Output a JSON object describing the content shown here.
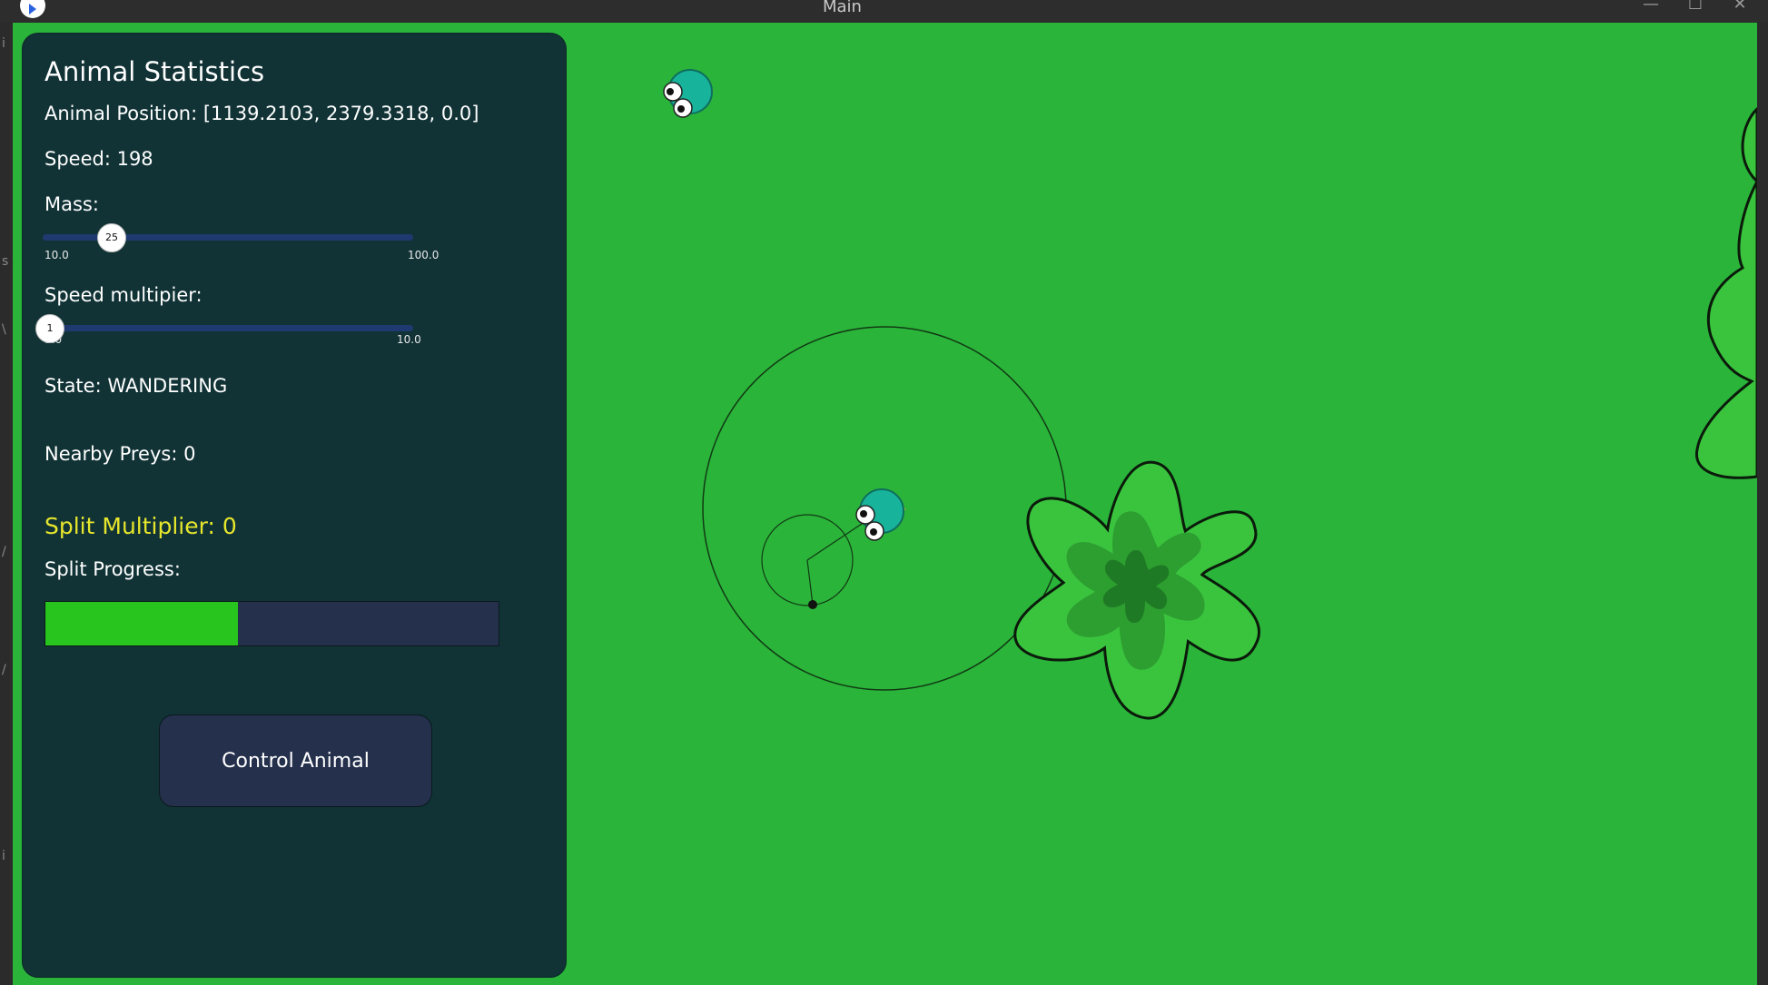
{
  "window": {
    "title": "Main",
    "minimize": "—",
    "maximize": "☐",
    "close": "✕"
  },
  "panel": {
    "title": "Animal Statistics",
    "position": "Animal Position: [1139.2103, 2379.3318, 0.0]",
    "speed": "Speed: 198",
    "mass_label": "Mass:",
    "mass_slider": {
      "value": 25,
      "value_label": "25",
      "min_label": "10.0",
      "max_label": "100.0",
      "min": 10,
      "max": 100
    },
    "speed_mult_label": "Speed multipier:",
    "speed_slider": {
      "value": 1,
      "value_label": "1",
      "min_label": "1.0",
      "max_label": "10.0",
      "min": 1,
      "max": 10
    },
    "state": "State: WANDERING",
    "nearby": "Nearby Preys: 0",
    "split_multiplier": "Split Multiplier: 0",
    "split_progress_label": "Split Progress:",
    "split_progress": 0.425,
    "control_button": "Control Animal"
  },
  "colors": {
    "grass": "#2ab43a",
    "panel_bg": "#113336",
    "accent_yellow": "#e6e62c",
    "progress_fill": "#27c51d",
    "control_bg": "#24304c",
    "animal_body": "#18b39b",
    "plant_light": "#3ac43e",
    "plant_mid": "#2d9e30",
    "plant_dark": "#1f7a25"
  },
  "left_strip_marks": [
    "i",
    "s",
    "\\",
    "/",
    "/",
    "i"
  ],
  "world": {
    "entities": [
      "animal-icon",
      "animal-icon",
      "plant-icon",
      "plant-icon"
    ]
  }
}
